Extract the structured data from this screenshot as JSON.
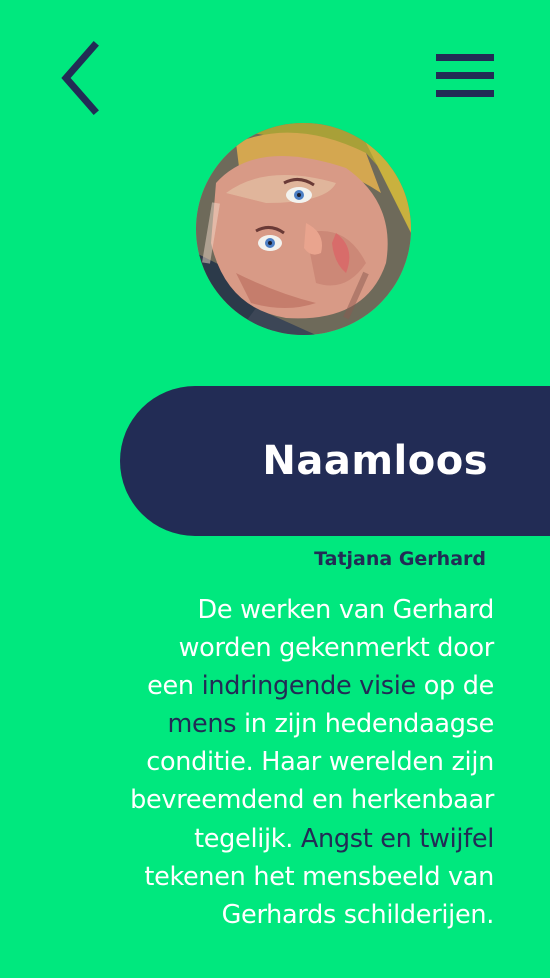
{
  "nav": {
    "back_icon": "chevron-left-icon",
    "menu_icon": "hamburger-menu-icon"
  },
  "artwork": {
    "image": "portrait painting of a face with blue eyes, tilted sideways",
    "title": "Naamloos",
    "artist": "Tatjana Gerhard"
  },
  "description": {
    "line1": "De werken van Gerhard",
    "line2": "worden gekenmerkt door",
    "line3_a": "een ",
    "line3_hl": "indringende visie",
    "line3_b": " op de",
    "line4_hl": "mens",
    "line4_b": " in zijn hedendaagse",
    "line5": "conditie. Haar werelden zijn",
    "line6": "bevreemdend en herkenbaar",
    "line7_a": "tegelijk. ",
    "line7_hl": "Angst en twijfel",
    "line8": "tekenen het mensbeeld van",
    "line9": "Gerhards schilderijen."
  },
  "colors": {
    "background": "#00e87e",
    "accent": "#222c55",
    "text": "#ffffff"
  }
}
